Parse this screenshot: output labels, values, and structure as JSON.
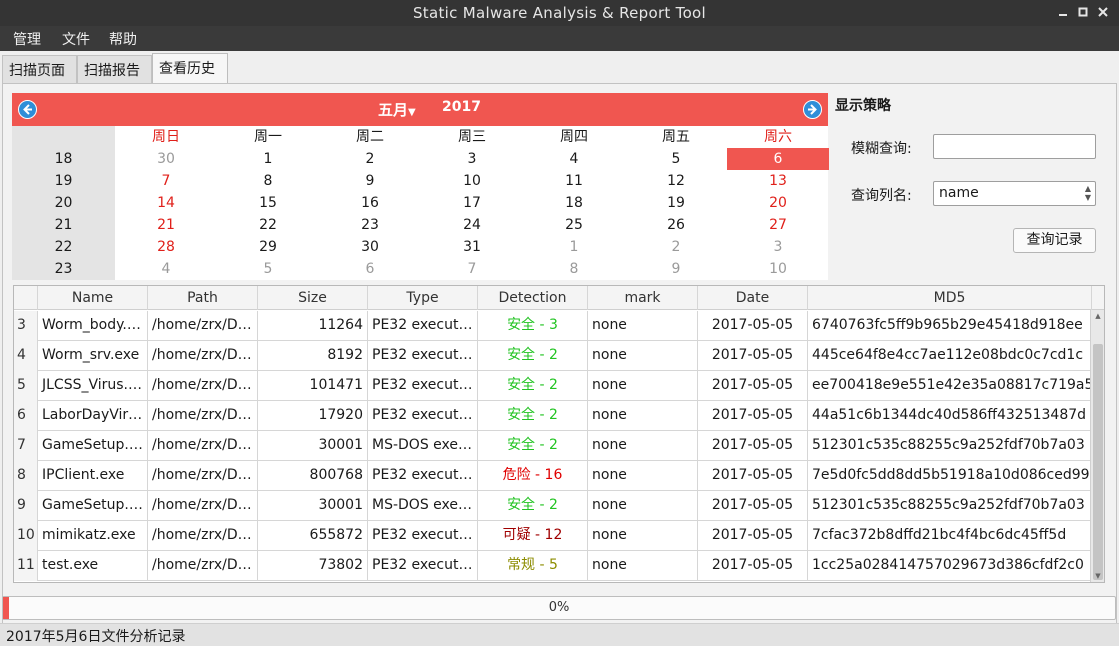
{
  "window": {
    "title": "Static Malware Analysis & Report Tool",
    "controls": [
      "minimize-icon",
      "maximize-icon",
      "close-icon"
    ]
  },
  "menu": [
    "管理",
    "文件",
    "帮助"
  ],
  "tabs": [
    "扫描页面",
    "扫描报告",
    "查看历史"
  ],
  "active_tab": "查看历史",
  "calendar": {
    "month": "五月",
    "year": "2017",
    "prev_icon": "left-arrow-icon",
    "next_icon": "right-arrow-icon",
    "accent_color": "#f05650",
    "weekdays": [
      "周日",
      "周一",
      "周二",
      "周三",
      "周四",
      "周五",
      "周六"
    ],
    "weeks": [
      {
        "num": "18",
        "days": [
          "30",
          "1",
          "2",
          "3",
          "4",
          "5",
          "6"
        ]
      },
      {
        "num": "19",
        "days": [
          "7",
          "8",
          "9",
          "10",
          "11",
          "12",
          "13"
        ]
      },
      {
        "num": "20",
        "days": [
          "14",
          "15",
          "16",
          "17",
          "18",
          "19",
          "20"
        ]
      },
      {
        "num": "21",
        "days": [
          "21",
          "22",
          "23",
          "24",
          "25",
          "26",
          "27"
        ]
      },
      {
        "num": "22",
        "days": [
          "28",
          "29",
          "30",
          "31",
          "1",
          "2",
          "3"
        ]
      },
      {
        "num": "23",
        "days": [
          "4",
          "5",
          "6",
          "7",
          "8",
          "9",
          "10"
        ]
      }
    ],
    "selected": "6"
  },
  "panel": {
    "title": "显示策略",
    "fuzzy_label": "模糊查询:",
    "fuzzy_value": "",
    "column_label": "查询列名:",
    "column_value": "name",
    "query_button": "查询记录"
  },
  "table": {
    "columns": [
      "Name",
      "Path",
      "Size",
      "Type",
      "Detection",
      "mark",
      "Date",
      "MD5"
    ],
    "rows": [
      {
        "n": "3",
        "name": "Worm_body.…",
        "path": "/home/zrx/D…",
        "size": "11264",
        "type": "PE32 execut…",
        "detection": "安全 - 3",
        "level": "safe",
        "mark": "none",
        "date": "2017-05-05",
        "md5": "6740763fc5ff9b965b29e45418d918ee"
      },
      {
        "n": "4",
        "name": "Worm_srv.exe",
        "path": "/home/zrx/D…",
        "size": "8192",
        "type": "PE32 execut…",
        "detection": "安全 - 2",
        "level": "safe",
        "mark": "none",
        "date": "2017-05-05",
        "md5": "445ce64f8e4cc7ae112e08bdc0c7cd1c"
      },
      {
        "n": "5",
        "name": "JLCSS_Virus.…",
        "path": "/home/zrx/D…",
        "size": "101471",
        "type": "PE32 execut…",
        "detection": "安全 - 2",
        "level": "safe",
        "mark": "none",
        "date": "2017-05-05",
        "md5": "ee700418e9e551e42e35a08817c719a5"
      },
      {
        "n": "6",
        "name": "LaborDayVir…",
        "path": "/home/zrx/D…",
        "size": "17920",
        "type": "PE32 execut…",
        "detection": "安全 - 2",
        "level": "safe",
        "mark": "none",
        "date": "2017-05-05",
        "md5": "44a51c6b1344dc40d586ff432513487d"
      },
      {
        "n": "7",
        "name": "GameSetup.…",
        "path": "/home/zrx/D…",
        "size": "30001",
        "type": "MS-DOS exe…",
        "detection": "安全 - 2",
        "level": "safe",
        "mark": "none",
        "date": "2017-05-05",
        "md5": "512301c535c88255c9a252fdf70b7a03"
      },
      {
        "n": "8",
        "name": "IPClient.exe",
        "path": "/home/zrx/D…",
        "size": "800768",
        "type": "PE32 execut…",
        "detection": "危险 - 16",
        "level": "danger",
        "mark": "none",
        "date": "2017-05-05",
        "md5": "7e5d0fc5dd8dd5b51918a10d086ced99"
      },
      {
        "n": "9",
        "name": "GameSetup.…",
        "path": "/home/zrx/D…",
        "size": "30001",
        "type": "MS-DOS exe…",
        "detection": "安全 - 2",
        "level": "safe",
        "mark": "none",
        "date": "2017-05-05",
        "md5": "512301c535c88255c9a252fdf70b7a03"
      },
      {
        "n": "10",
        "name": "mimikatz.exe",
        "path": "/home/zrx/D…",
        "size": "655872",
        "type": "PE32 execut…",
        "detection": "可疑 - 12",
        "level": "suspicious",
        "mark": "none",
        "date": "2017-05-05",
        "md5": "7cfac372b8dffd21bc4f4bc6dc45ff5d"
      },
      {
        "n": "11",
        "name": "test.exe",
        "path": "/home/zrx/D…",
        "size": "73802",
        "type": "PE32 execut…",
        "detection": "常规 - 5",
        "level": "normal",
        "mark": "none",
        "date": "2017-05-05",
        "md5": "1cc25a028414757029673d386cfdf2c0"
      }
    ],
    "level_colors": {
      "safe": "#22c322",
      "danger": "#e00000",
      "suspicious": "#a00000",
      "normal": "#8c8c00"
    }
  },
  "progress": {
    "text": "0%",
    "value": 0.005
  },
  "status": "2017年5月6日文件分析记录"
}
